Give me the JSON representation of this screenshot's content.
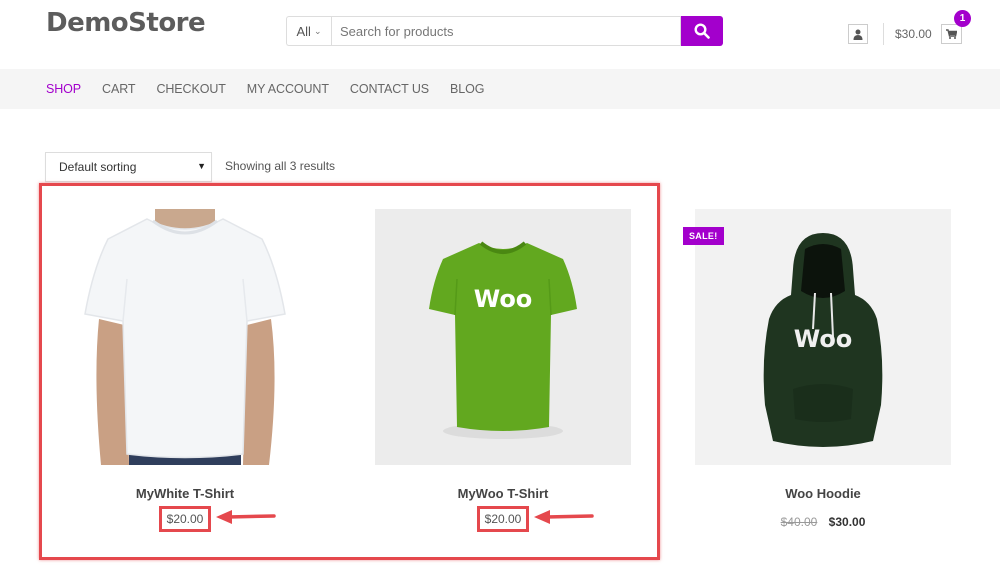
{
  "header": {
    "logo": "DemoStore",
    "search": {
      "category": "All",
      "placeholder": "Search for products",
      "value": ""
    },
    "cart_total": "$30.00",
    "cart_count": "1"
  },
  "nav": {
    "items": [
      {
        "label": "SHOP",
        "active": true
      },
      {
        "label": "CART",
        "active": false
      },
      {
        "label": "CHECKOUT",
        "active": false
      },
      {
        "label": "MY ACCOUNT",
        "active": false
      },
      {
        "label": "CONTACT US",
        "active": false
      },
      {
        "label": "BLOG",
        "active": false
      }
    ]
  },
  "toolbar": {
    "sorting": "Default sorting",
    "result_count": "Showing all 3 results"
  },
  "products": [
    {
      "title": "MyWhite T-Shirt",
      "price": "$20.00",
      "highlighted": true
    },
    {
      "title": "MyWoo T-Shirt",
      "price": "$20.00",
      "highlighted": true
    },
    {
      "title": "Woo Hoodie",
      "regular_price": "$40.00",
      "sale_price": "$30.00",
      "badge": "SALE!"
    }
  ],
  "colors": {
    "accent": "#a300cc",
    "annotation": "#e5484d"
  }
}
